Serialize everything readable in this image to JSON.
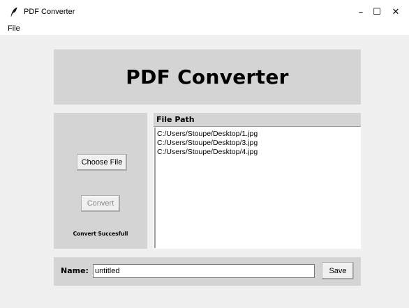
{
  "window": {
    "title": "PDF Converter",
    "minimize_glyph": "–",
    "maximize_glyph": "☐",
    "close_glyph": "✕"
  },
  "menu": {
    "items": [
      "File"
    ]
  },
  "header": {
    "title": "PDF Converter"
  },
  "controls": {
    "choose_file_label": "Choose File",
    "convert_label": "Convert",
    "convert_enabled": false,
    "status_text": "Convert Succesfull"
  },
  "file_list": {
    "header": "File Path",
    "items": [
      "C:/Users/Stoupe/Desktop/1.jpg",
      "C:/Users/Stoupe/Desktop/3.jpg",
      "C:/Users/Stoupe/Desktop/4.jpg"
    ]
  },
  "footer": {
    "name_label": "Name:",
    "name_value": "untitled",
    "save_label": "Save"
  },
  "icons": {
    "app": "feather-icon",
    "minimize": "minimize-icon",
    "maximize": "maximize-icon",
    "close": "close-icon"
  },
  "colors": {
    "panel_bg": "#d4d4d4",
    "window_bg": "#f0f0f0",
    "list_bg": "#ffffff",
    "disabled_text": "#8a8a8a"
  }
}
